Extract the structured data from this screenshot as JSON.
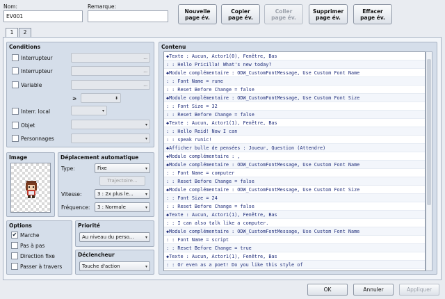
{
  "header": {
    "name_label": "Nom:",
    "name_value": "EV001",
    "remark_label": "Remarque:",
    "remark_value": ""
  },
  "toolbar": {
    "new_label": "Nouvelle\npage év.",
    "copy_label": "Copier\npage év.",
    "paste_label": "Coller\npage év.",
    "delete_label": "Supprimer\npage év.",
    "clear_label": "Effacer\npage év."
  },
  "tabs": [
    "1",
    "2"
  ],
  "conditions": {
    "title": "Conditions",
    "switch1": "Interrupteur",
    "switch2": "Interrupteur",
    "variable": "Variable",
    "gte": "≥",
    "self_switch": "Interr. local",
    "item": "Objet",
    "actor": "Personnages",
    "dots": "..."
  },
  "image": {
    "title": "Image"
  },
  "movement": {
    "title": "Déplacement automatique",
    "type_label": "Type:",
    "type_value": "Fixe",
    "route_button": "Trajectoire...",
    "speed_label": "Vitesse:",
    "speed_value": "3 : 2x plus le...",
    "freq_label": "Fréquence:",
    "freq_value": "3 : Normale"
  },
  "options": {
    "title": "Options",
    "walk": "Marche",
    "step": "Pas à pas",
    "dirfix": "Direction fixe",
    "through": "Passer à travers",
    "walk_check": "✔"
  },
  "priority": {
    "title": "Priorité",
    "value": "Au niveau du perso..."
  },
  "trigger": {
    "title": "Déclencheur",
    "value": "Touche d'action"
  },
  "contents": {
    "title": "Contenu",
    "lines": [
      "◆Texte : Aucun, Actor1(0), Fenêtre, Bas",
      "  :      : Hello Pricilla! What's new today?",
      "◆Module complémentaire : ODW_CustomFontMessage, Use Custom Font Name",
      "  :                     : Font Name = rune",
      "  :                     : Reset Before Change = false",
      "◆Module complémentaire : ODW_CustomFontMessage, Use Custom Font Size",
      "  :                     : Font Size = 32",
      "  :                     : Reset Before Change = false",
      "◆Texte : Aucun, Actor1(1), Fenêtre, Bas",
      "  :      : Hello Reid! Now I can",
      "  :      : speak runic!",
      "◆Afficher bulle de pensées : Joueur, Question (Attendre)",
      "◆Module complémentaire : ,",
      "◆Module complémentaire : ODW_CustomFontMessage, Use Custom Font Name",
      "  :                     : Font Name = computer",
      "  :                     : Reset Before Change = false",
      "◆Module complémentaire : ODW_CustomFontMessage, Use Custom Font Size",
      "  :                     : Font Size = 24",
      "  :                     : Reset Before Change = false",
      "◆Texte : Aucun, Actor1(1), Fenêtre, Bas",
      "  :      : I can also talk like a computer.",
      "◆Module complémentaire : ODW_CustomFontMessage, Use Custom Font Name",
      "  :                     : Font Name = script",
      "  :                     : Reset Before Change = true",
      "◆Texte : Aucun, Actor1(1), Fenêtre, Bas",
      "  :      : Or even as a poet! Do you like this style of"
    ]
  },
  "footer": {
    "ok": "OK",
    "cancel": "Annuler",
    "apply": "Appliquer"
  }
}
